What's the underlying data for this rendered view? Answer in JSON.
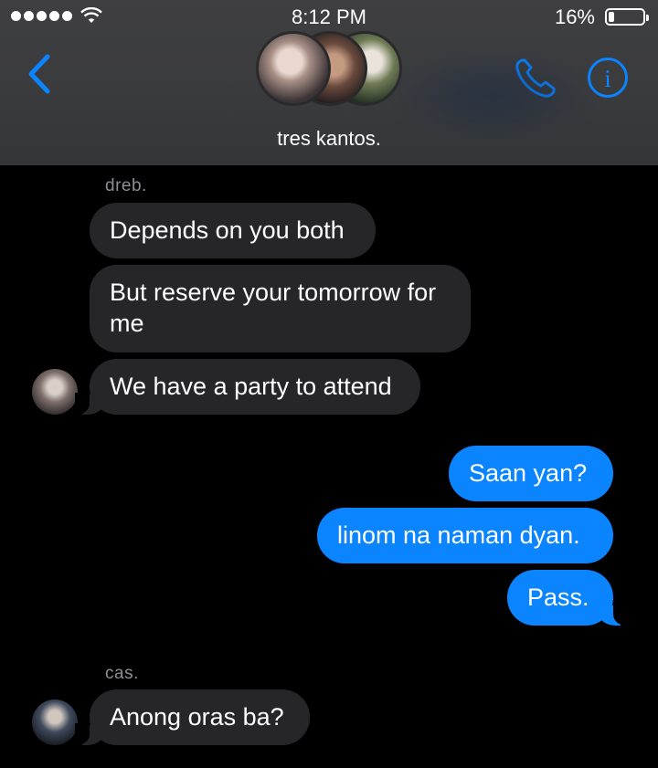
{
  "status_bar": {
    "time": "8:12 PM",
    "battery_percent": "16%",
    "battery_level": 0.16,
    "signal_bars": 5
  },
  "header": {
    "back_icon": "chevron-left-icon",
    "group_name": "tres kantos.",
    "phone_icon": "phone-icon",
    "info_icon": "info-icon",
    "accent_color": "#0a84ff"
  },
  "messages": [
    {
      "sender": "dreb.",
      "direction": "incoming",
      "text": "Depends on you both"
    },
    {
      "sender": "dreb.",
      "direction": "incoming",
      "text_line1": "But reserve your tomorrow for",
      "text_line2": "me"
    },
    {
      "sender": "dreb.",
      "direction": "incoming",
      "text": "We have a party to attend"
    },
    {
      "direction": "outgoing",
      "text": "Saan yan?"
    },
    {
      "direction": "outgoing",
      "text": "linom na naman dyan."
    },
    {
      "direction": "outgoing",
      "text": "Pass."
    },
    {
      "sender": "cas.",
      "direction": "incoming",
      "text": "Anong oras ba?"
    }
  ],
  "colors": {
    "incoming_bubble": "#262628",
    "outgoing_bubble": "#0a84ff",
    "background": "#000000"
  }
}
